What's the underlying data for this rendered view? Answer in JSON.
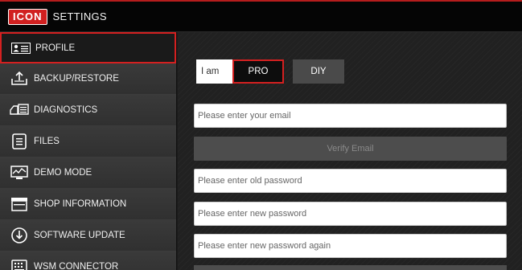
{
  "header": {
    "logo_text": "ICON",
    "title": "SETTINGS",
    "accent_color": "#d42020"
  },
  "sidebar": {
    "items": [
      {
        "label": "PROFILE",
        "icon": "profile-card-icon",
        "active": true
      },
      {
        "label": "BACKUP/RESTORE",
        "icon": "backup-restore-icon",
        "active": false
      },
      {
        "label": "DIAGNOSTICS",
        "icon": "diagnostics-truck-icon",
        "active": false
      },
      {
        "label": "FILES",
        "icon": "files-icon",
        "active": false
      },
      {
        "label": "DEMO MODE",
        "icon": "demo-monitor-icon",
        "active": false
      },
      {
        "label": "SHOP INFORMATION",
        "icon": "shop-icon",
        "active": false
      },
      {
        "label": "SOFTWARE UPDATE",
        "icon": "software-update-icon",
        "active": false
      },
      {
        "label": "WSM CONNECTOR",
        "icon": "wsm-connector-icon",
        "active": false
      }
    ]
  },
  "profile": {
    "role_label": "I am",
    "role_options": [
      "PRO",
      "DIY"
    ],
    "selected_role": "PRO",
    "email_placeholder": "Please enter your email",
    "verify_label": "Verify Email",
    "old_password_placeholder": "Please enter old password",
    "new_password_placeholder": "Please enter new password",
    "new_password_again_placeholder": "Please enter new password again"
  }
}
